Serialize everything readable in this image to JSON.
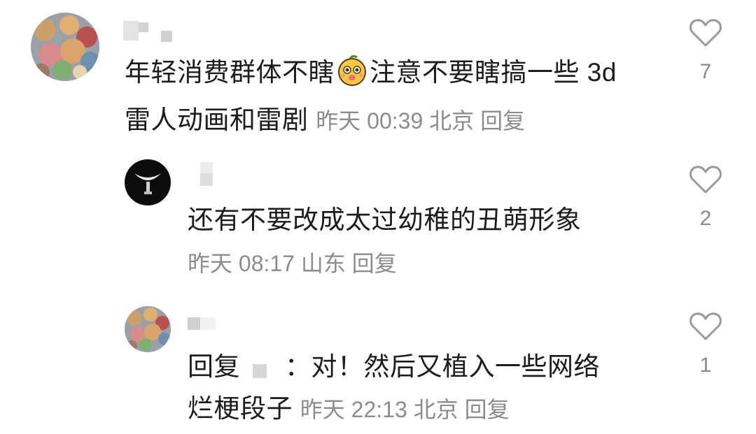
{
  "comments": [
    {
      "text_before_emoji": "年轻消费群体不瞎",
      "emoji": "cute-face-emoji",
      "text_after_emoji": "注意不要瞎搞一些 3d",
      "text_line2": "雷人动画和雷剧",
      "time": "昨天 00:39",
      "location": "北京",
      "reply_label": "回复",
      "like_count": "7"
    },
    {
      "text": "还有不要改成太过幼稚的丑萌形象",
      "time": "昨天 08:17",
      "location": "山东",
      "reply_label": "回复",
      "like_count": "2"
    },
    {
      "reply_prefix": "回复",
      "text_line1": "：对！然后又植入一些网络",
      "text_line2": "烂梗段子",
      "time": "昨天 22:13",
      "location": "北京",
      "reply_label": "回复",
      "like_count": "1"
    }
  ],
  "colors": {
    "text": "#1c1c1c",
    "meta": "#8c8c8c",
    "heart_outline": "#9a9a9a"
  }
}
